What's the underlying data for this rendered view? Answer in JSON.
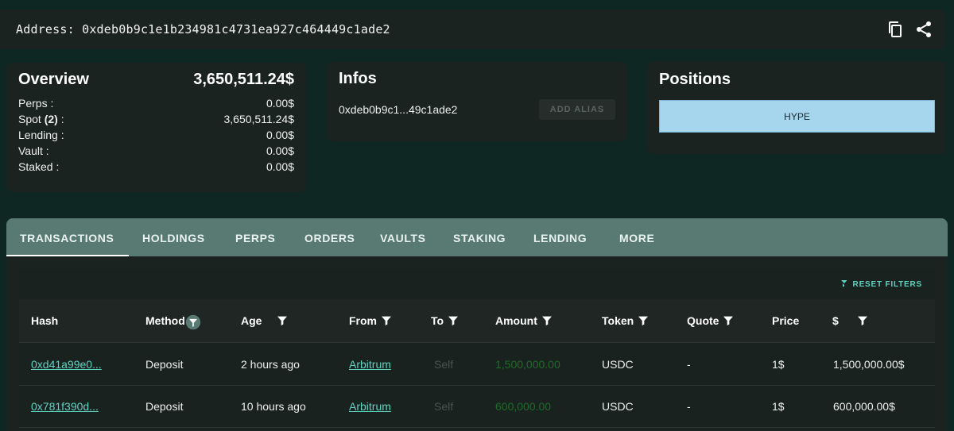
{
  "address": {
    "label": "Address:",
    "value": "0xdeb0b9c1e1b234981c4731ea927c464449c1ade2"
  },
  "overview": {
    "title": "Overview",
    "total": "3,650,511.24$",
    "rows": [
      {
        "label": "Perps :",
        "value": "0.00$"
      },
      {
        "label": "Spot",
        "badge": "(2)",
        "suffix": " :",
        "value": "3,650,511.24$"
      },
      {
        "label": "Lending :",
        "value": "0.00$"
      },
      {
        "label": "Vault :",
        "value": "0.00$"
      },
      {
        "label": "Staked :",
        "value": "0.00$"
      }
    ]
  },
  "infos": {
    "title": "Infos",
    "short_address": "0xdeb0b9c1...49c1ade2",
    "alias_button": "ADD ALIAS"
  },
  "positions": {
    "title": "Positions",
    "items": [
      "HYPE"
    ]
  },
  "tabs": [
    "TRANSACTIONS",
    "HOLDINGS",
    "PERPS",
    "ORDERS",
    "VAULTS",
    "STAKING",
    "LENDING",
    "MORE"
  ],
  "table": {
    "reset_label": "RESET FILTERS",
    "headers": [
      "Hash",
      "Method",
      "Age",
      "From",
      "To",
      "Amount",
      "Token",
      "Quote",
      "Price",
      "$"
    ],
    "rows": [
      {
        "hash": "0xd41a99e0...",
        "method": "Deposit",
        "age": "2 hours ago",
        "from": "Arbitrum",
        "to": "Self",
        "amount": "1,500,000.00",
        "token": "USDC",
        "quote": "-",
        "price": "1$",
        "usd": "1,500,000.00$"
      },
      {
        "hash": "0x781f390d...",
        "method": "Deposit",
        "age": "10 hours ago",
        "from": "Arbitrum",
        "to": "Self",
        "amount": "600,000.00",
        "token": "USDC",
        "quote": "-",
        "price": "1$",
        "usd": "600,000.00$"
      }
    ]
  },
  "colors": {
    "background": "#0f2723",
    "card": "#1b2321",
    "tab_bar": "#587a72",
    "link": "#5fd3c2",
    "position_button": "#a6d5ee"
  },
  "icons": {
    "copy": "copy-icon",
    "share": "share-icon",
    "filter": "filter-icon",
    "reset": "filter-off-icon"
  }
}
